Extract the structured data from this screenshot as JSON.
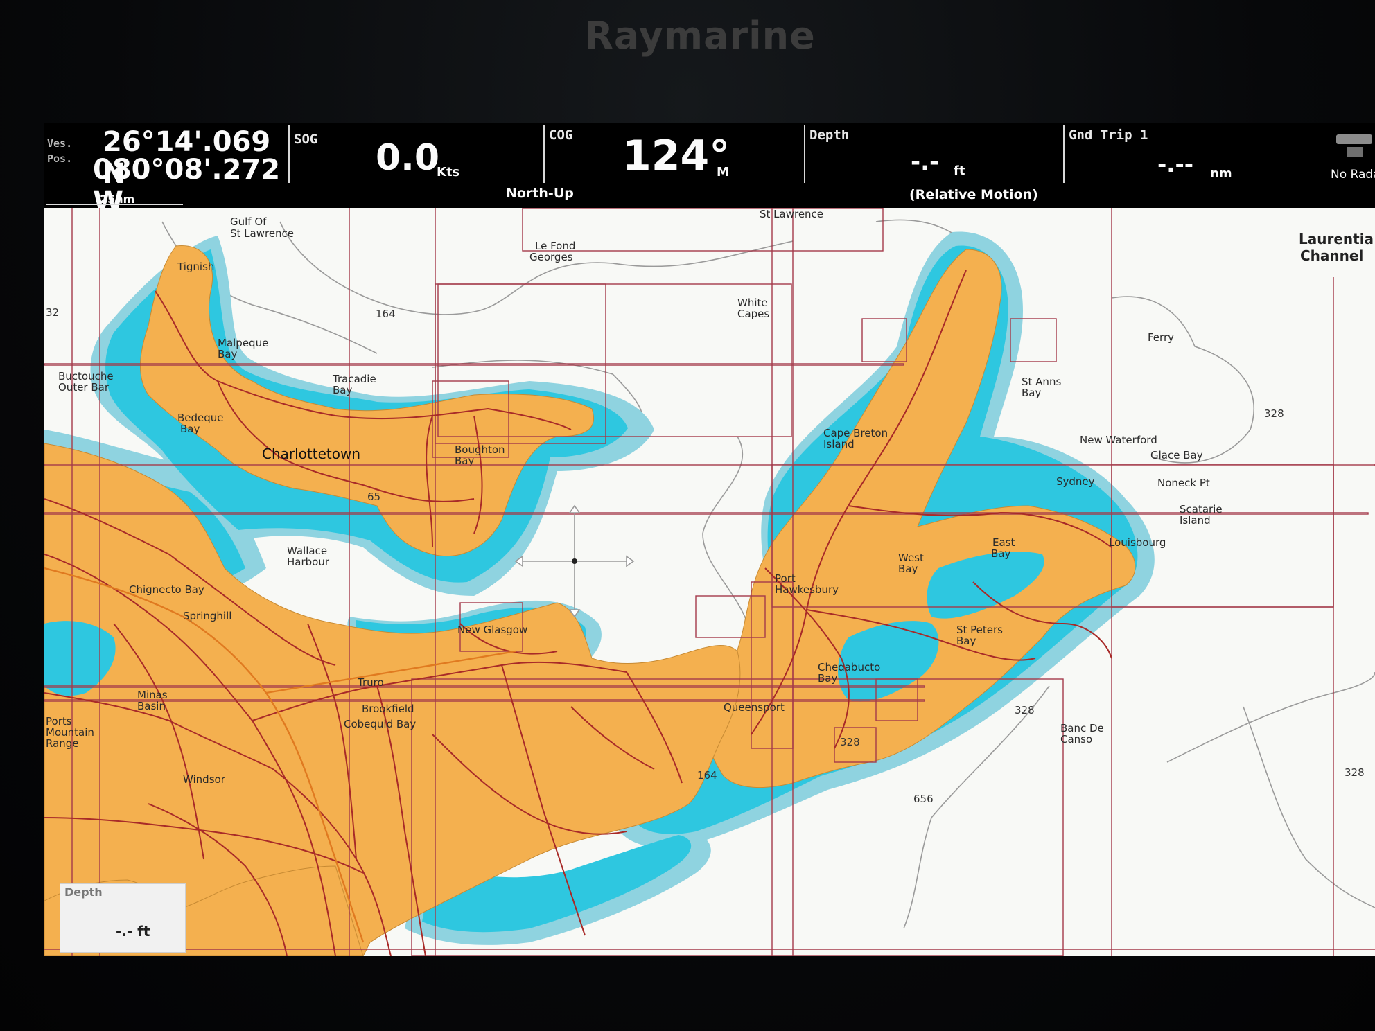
{
  "brand": "Raymarine",
  "databar": {
    "position": {
      "label_line1": "Ves.",
      "label_line2": "Pos.",
      "lat": "26°14'.069 N",
      "lon": "080°08'.272 W",
      "scale": "25nm"
    },
    "sog": {
      "label": "SOG",
      "value": "0.0",
      "unit": "Kts"
    },
    "cog": {
      "label": "COG",
      "value": "124°",
      "unit": "M",
      "orientation": "North-Up"
    },
    "depth": {
      "label": "Depth",
      "value": "-.-",
      "unit": "ft",
      "motion": "(Relative Motion)"
    },
    "trip": {
      "label": "Gnd Trip 1",
      "value": "-.--",
      "unit": "nm"
    },
    "radar": {
      "label": "No Radar"
    }
  },
  "chart": {
    "places": {
      "gulf_stl": [
        "Gulf Of",
        "St Lawrence"
      ],
      "le_fond": [
        "Le Fond",
        "Georges"
      ],
      "st_lawrence": "St Lawrence",
      "laurentian": [
        "Laurentia",
        "Channel"
      ],
      "tignish": "Tignish",
      "malpeque": [
        "Malpeque",
        "Bay"
      ],
      "buctouche": [
        "Buctouche",
        "Outer Bar"
      ],
      "bedeque": [
        "Bedeque",
        "Bay"
      ],
      "tracadie": [
        "Tracadie",
        "Bay"
      ],
      "charlottetown": "Charlottetown",
      "boughton": [
        "Boughton",
        "Bay"
      ],
      "white_capes": [
        "White",
        "Capes"
      ],
      "ferry": "Ferry",
      "st_anns": [
        "St Anns",
        "Bay"
      ],
      "cape_breton": [
        "Cape Breton",
        "Island"
      ],
      "new_waterford": "New Waterford",
      "glace_bay": "Glace Bay",
      "sydney": "Sydney",
      "noneck": "Noneck Pt",
      "scatarie": [
        "Scatarie",
        "Island"
      ],
      "louisbourg": "Louisbourg",
      "east_bay": [
        "East",
        "Bay"
      ],
      "west_bay": [
        "West",
        "Bay"
      ],
      "port_hawkesbury": [
        "Port",
        "Hawkesbury"
      ],
      "st_peters": [
        "St Peters",
        "Bay"
      ],
      "chedabucto": [
        "Chedabucto",
        "Bay"
      ],
      "wallace": [
        "Wallace",
        "Harbour"
      ],
      "chignecto": "Chignecto Bay",
      "springhill": "Springhill",
      "new_glasgow": "New Glasgow",
      "truro": "Truro",
      "minas": [
        "Minas",
        "Basin"
      ],
      "brookfield": "Brookfield",
      "cobequid": "Cobequid Bay",
      "queensport": "Queensport",
      "banc": [
        "Banc De",
        "Canso"
      ],
      "windsor": "Windsor",
      "ports": [
        "Ports",
        "Mountain",
        "Range"
      ]
    },
    "depths": {
      "d164a": "164",
      "d164b": "164",
      "d328a": "328",
      "d328b": "328",
      "d328c": "328",
      "d328d": "328",
      "d656": "656",
      "d32": "32",
      "d65": "65"
    },
    "depth_box": {
      "label": "Depth",
      "value": "-.- ft"
    }
  }
}
